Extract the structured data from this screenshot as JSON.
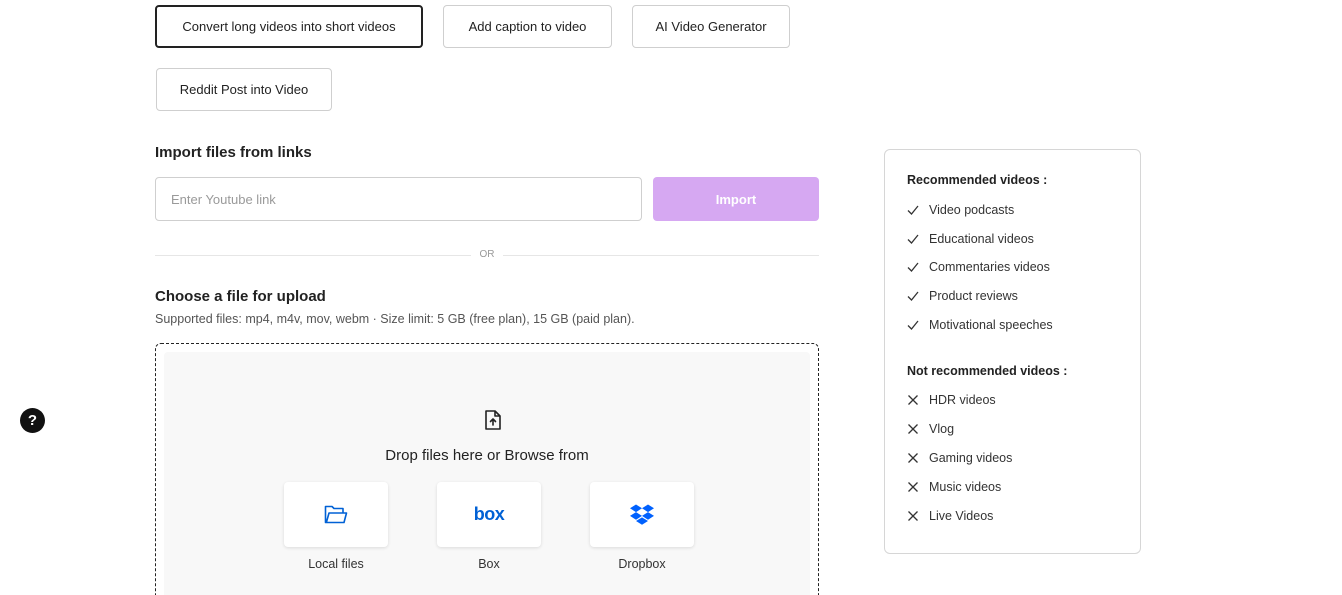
{
  "tools": [
    {
      "label": "Convert long videos into short videos",
      "active": true
    },
    {
      "label": "Add caption to video",
      "active": false
    },
    {
      "label": "AI Video Generator",
      "active": false
    },
    {
      "label": "Reddit Post into Video",
      "active": false
    }
  ],
  "import": {
    "title": "Import files from links",
    "placeholder": "Enter Youtube link",
    "button_label": "Import",
    "divider_text": "OR"
  },
  "upload": {
    "title": "Choose a file for upload",
    "supported": "Supported files: mp4, m4v, mov, webm  ·  Size limit: 5 GB (free plan), 15 GB (paid plan).",
    "drop_text": "Drop files here or Browse from",
    "sources": [
      {
        "label": "Local files",
        "icon": "folder-icon"
      },
      {
        "label": "Box",
        "icon": "box-logo-icon",
        "logo_text": "box"
      },
      {
        "label": "Dropbox",
        "icon": "dropbox-icon"
      }
    ]
  },
  "help": {
    "glyph": "?"
  },
  "recommendations": {
    "recommended_title": "Recommended videos :",
    "recommended": [
      "Video podcasts",
      "Educational videos",
      "Commentaries videos",
      "Product reviews",
      "Motivational speeches"
    ],
    "not_recommended_title": "Not recommended videos :",
    "not_recommended": [
      "HDR videos",
      "Vlog",
      "Gaming videos",
      "Music videos",
      "Live Videos"
    ]
  },
  "colors": {
    "accent": "#d6a8f2",
    "box_blue": "#0061d5",
    "dropbox_blue": "#0061fe"
  }
}
